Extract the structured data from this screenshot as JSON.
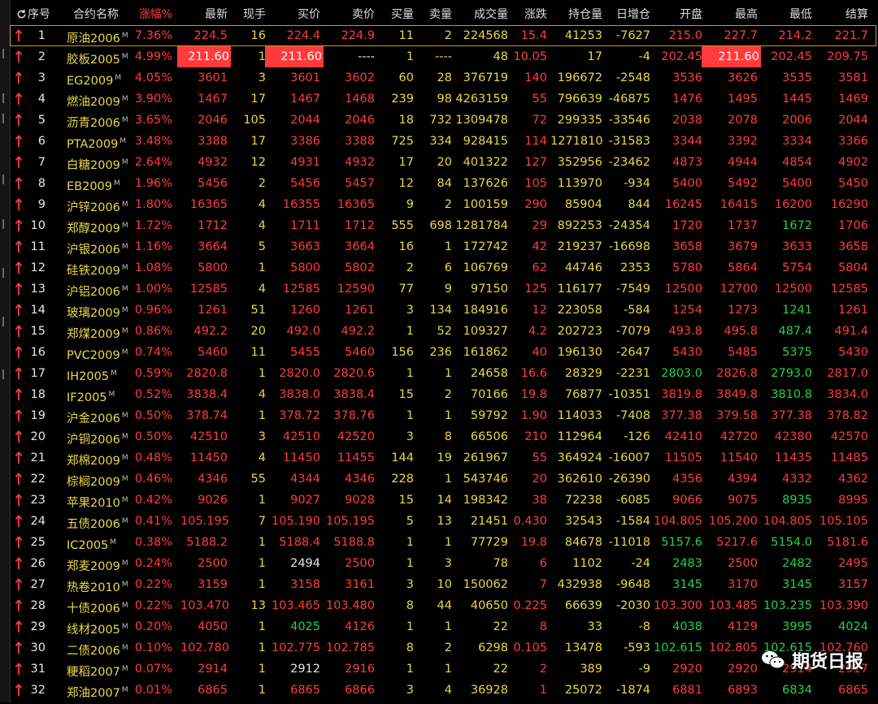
{
  "headers": [
    "序号",
    "合约名称",
    "涨幅%",
    "最新",
    "现手",
    "买价",
    "卖价",
    "买量",
    "卖量",
    "成交量",
    "涨跌",
    "持仓量",
    "日增仓",
    "开盘",
    "最高",
    "最低",
    "结算"
  ],
  "rows": [
    [
      "1",
      "原油2006",
      "7.36%",
      "224.5",
      "16",
      "224.4",
      "224.9",
      "11",
      "2",
      "224568",
      "15.4",
      "41253",
      "-7627",
      "215.0",
      "227.7",
      "214.2",
      "221.7"
    ],
    [
      "2",
      "胶板2005",
      "4.99%",
      "211.60",
      "1",
      "211.60",
      "----",
      "1",
      "----",
      "48",
      "10.05",
      "17",
      "-4",
      "202.45",
      "211.60",
      "202.45",
      "209.75"
    ],
    [
      "3",
      "EG2009",
      "4.05%",
      "3601",
      "3",
      "3601",
      "3602",
      "60",
      "28",
      "376719",
      "140",
      "196672",
      "-2548",
      "3536",
      "3626",
      "3535",
      "3581"
    ],
    [
      "4",
      "燃油2009",
      "3.90%",
      "1467",
      "17",
      "1467",
      "1468",
      "239",
      "98",
      "4263159",
      "55",
      "796639",
      "-46875",
      "1476",
      "1495",
      "1445",
      "1469"
    ],
    [
      "5",
      "沥青2006",
      "3.65%",
      "2046",
      "105",
      "2044",
      "2046",
      "18",
      "732",
      "1309478",
      "72",
      "299335",
      "-33546",
      "2038",
      "2078",
      "2006",
      "2044"
    ],
    [
      "6",
      "PTA2009",
      "3.48%",
      "3388",
      "17",
      "3386",
      "3388",
      "725",
      "334",
      "928415",
      "114",
      "1271810",
      "-31583",
      "3344",
      "3392",
      "3334",
      "3366"
    ],
    [
      "7",
      "白糖2009",
      "2.64%",
      "4932",
      "12",
      "4931",
      "4932",
      "17",
      "20",
      "401322",
      "127",
      "352956",
      "-23462",
      "4873",
      "4944",
      "4854",
      "4902"
    ],
    [
      "8",
      "EB2009",
      "1.96%",
      "5456",
      "2",
      "5456",
      "5457",
      "12",
      "84",
      "137626",
      "105",
      "113970",
      "-934",
      "5400",
      "5492",
      "5400",
      "5450"
    ],
    [
      "9",
      "沪锌2006",
      "1.80%",
      "16365",
      "4",
      "16355",
      "16365",
      "9",
      "2",
      "100159",
      "290",
      "85904",
      "844",
      "16245",
      "16415",
      "16200",
      "16290"
    ],
    [
      "10",
      "郑醇2009",
      "1.72%",
      "1712",
      "4",
      "1711",
      "1712",
      "555",
      "698",
      "1281784",
      "29",
      "892253",
      "-24354",
      "1720",
      "1737",
      "1672",
      "1706"
    ],
    [
      "11",
      "沪银2006",
      "1.16%",
      "3664",
      "5",
      "3663",
      "3664",
      "16",
      "1",
      "172742",
      "42",
      "219237",
      "-16698",
      "3658",
      "3679",
      "3633",
      "3658"
    ],
    [
      "12",
      "硅铁2009",
      "1.08%",
      "5800",
      "1",
      "5800",
      "5802",
      "2",
      "6",
      "106769",
      "62",
      "44746",
      "2353",
      "5780",
      "5864",
      "5754",
      "5804"
    ],
    [
      "13",
      "沪铝2006",
      "1.00%",
      "12585",
      "4",
      "12585",
      "12590",
      "77",
      "9",
      "97150",
      "125",
      "116177",
      "-7549",
      "12500",
      "12700",
      "12500",
      "12585"
    ],
    [
      "14",
      "玻璃2009",
      "0.96%",
      "1261",
      "51",
      "1260",
      "1261",
      "3",
      "134",
      "184916",
      "12",
      "223058",
      "-584",
      "1254",
      "1273",
      "1241",
      "1261"
    ],
    [
      "15",
      "郑煤2009",
      "0.86%",
      "492.2",
      "20",
      "492.0",
      "492.2",
      "1",
      "52",
      "109327",
      "4.2",
      "202723",
      "-7079",
      "493.8",
      "495.8",
      "487.4",
      "491.4"
    ],
    [
      "16",
      "PVC2009",
      "0.74%",
      "5460",
      "11",
      "5455",
      "5460",
      "156",
      "236",
      "161862",
      "40",
      "196130",
      "-2647",
      "5430",
      "5485",
      "5375",
      "5430"
    ],
    [
      "17",
      "IH2005",
      "0.59%",
      "2820.8",
      "1",
      "2820.0",
      "2820.6",
      "1",
      "1",
      "24658",
      "16.6",
      "28329",
      "-2231",
      "2803.0",
      "2826.8",
      "2793.0",
      "2817.0"
    ],
    [
      "18",
      "IF2005",
      "0.52%",
      "3838.4",
      "4",
      "3838.0",
      "3838.4",
      "15",
      "2",
      "70166",
      "19.8",
      "76877",
      "-10351",
      "3819.8",
      "3849.8",
      "3810.8",
      "3834.0"
    ],
    [
      "19",
      "沪金2006",
      "0.50%",
      "378.74",
      "1",
      "378.72",
      "378.76",
      "1",
      "1",
      "59792",
      "1.90",
      "114033",
      "-7408",
      "377.38",
      "379.58",
      "377.38",
      "378.82"
    ],
    [
      "20",
      "沪铜2006",
      "0.50%",
      "42510",
      "3",
      "42510",
      "42520",
      "3",
      "8",
      "66506",
      "210",
      "112964",
      "-126",
      "42410",
      "42720",
      "42380",
      "42570"
    ],
    [
      "21",
      "郑棉2009",
      "0.48%",
      "11450",
      "4",
      "11450",
      "11455",
      "144",
      "19",
      "261967",
      "55",
      "364924",
      "-16007",
      "11505",
      "11540",
      "11435",
      "11485"
    ],
    [
      "22",
      "棕榈2009",
      "0.46%",
      "4346",
      "55",
      "4344",
      "4346",
      "228",
      "1",
      "543746",
      "20",
      "362610",
      "-26390",
      "4356",
      "4394",
      "4332",
      "4362"
    ],
    [
      "23",
      "苹果2010",
      "0.42%",
      "9026",
      "1",
      "9027",
      "9028",
      "15",
      "14",
      "198342",
      "38",
      "72238",
      "-6085",
      "9066",
      "9075",
      "8935",
      "8995"
    ],
    [
      "24",
      "五债2006",
      "0.41%",
      "105.195",
      "7",
      "105.190",
      "105.195",
      "5",
      "13",
      "21451",
      "0.430",
      "32543",
      "-1584",
      "104.805",
      "105.200",
      "104.805",
      "105.105"
    ],
    [
      "25",
      "IC2005",
      "0.38%",
      "5188.2",
      "1",
      "5188.4",
      "5188.8",
      "1",
      "1",
      "77729",
      "19.8",
      "84678",
      "-11018",
      "5157.6",
      "5217.6",
      "5154.0",
      "5181.6"
    ],
    [
      "26",
      "郑麦2009",
      "0.24%",
      "2500",
      "1",
      "2494",
      "2500",
      "1",
      "3",
      "78",
      "6",
      "1102",
      "-24",
      "2483",
      "2500",
      "2482",
      "2495"
    ],
    [
      "27",
      "热卷2010",
      "0.22%",
      "3159",
      "1",
      "3158",
      "3161",
      "3",
      "10",
      "150062",
      "7",
      "432938",
      "-9648",
      "3145",
      "3170",
      "3145",
      "3157"
    ],
    [
      "28",
      "十债2006",
      "0.22%",
      "103.470",
      "13",
      "103.465",
      "103.480",
      "8",
      "44",
      "40650",
      "0.225",
      "66639",
      "-2030",
      "103.300",
      "103.485",
      "103.235",
      "103.390"
    ],
    [
      "29",
      "线材2005",
      "0.20%",
      "4050",
      "1",
      "4025",
      "4126",
      "1",
      "1",
      "22",
      "8",
      "33",
      "-8",
      "4038",
      "4129",
      "3995",
      "4024"
    ],
    [
      "30",
      "二债2006",
      "0.10%",
      "102.780",
      "1",
      "102.775",
      "102.785",
      "8",
      "2",
      "6298",
      "0.105",
      "13478",
      "-593",
      "102.615",
      "102.805",
      "102.615",
      "102.760"
    ],
    [
      "31",
      "粳稻2007",
      "0.07%",
      "2914",
      "1",
      "2912",
      "2916",
      "1",
      "1",
      "22",
      "2",
      "389",
      "-9",
      "2920",
      "2920",
      "2914",
      "2917"
    ],
    [
      "32",
      "郑油2007",
      "0.01%",
      "6865",
      "1",
      "6865",
      "6866",
      "3",
      "4",
      "36928",
      "1",
      "25072",
      "-1874",
      "6881",
      "6893",
      "6834",
      "6865"
    ]
  ],
  "watermark": "期货日报",
  "contract_suffix": "M",
  "colors": {
    "up": "#ff3d3d",
    "down": "#22d24a",
    "neutral": "#e6e6e6",
    "name": "#e8d84a",
    "highlight": "#ff3b3b",
    "selected_border": "#c89a2a"
  }
}
